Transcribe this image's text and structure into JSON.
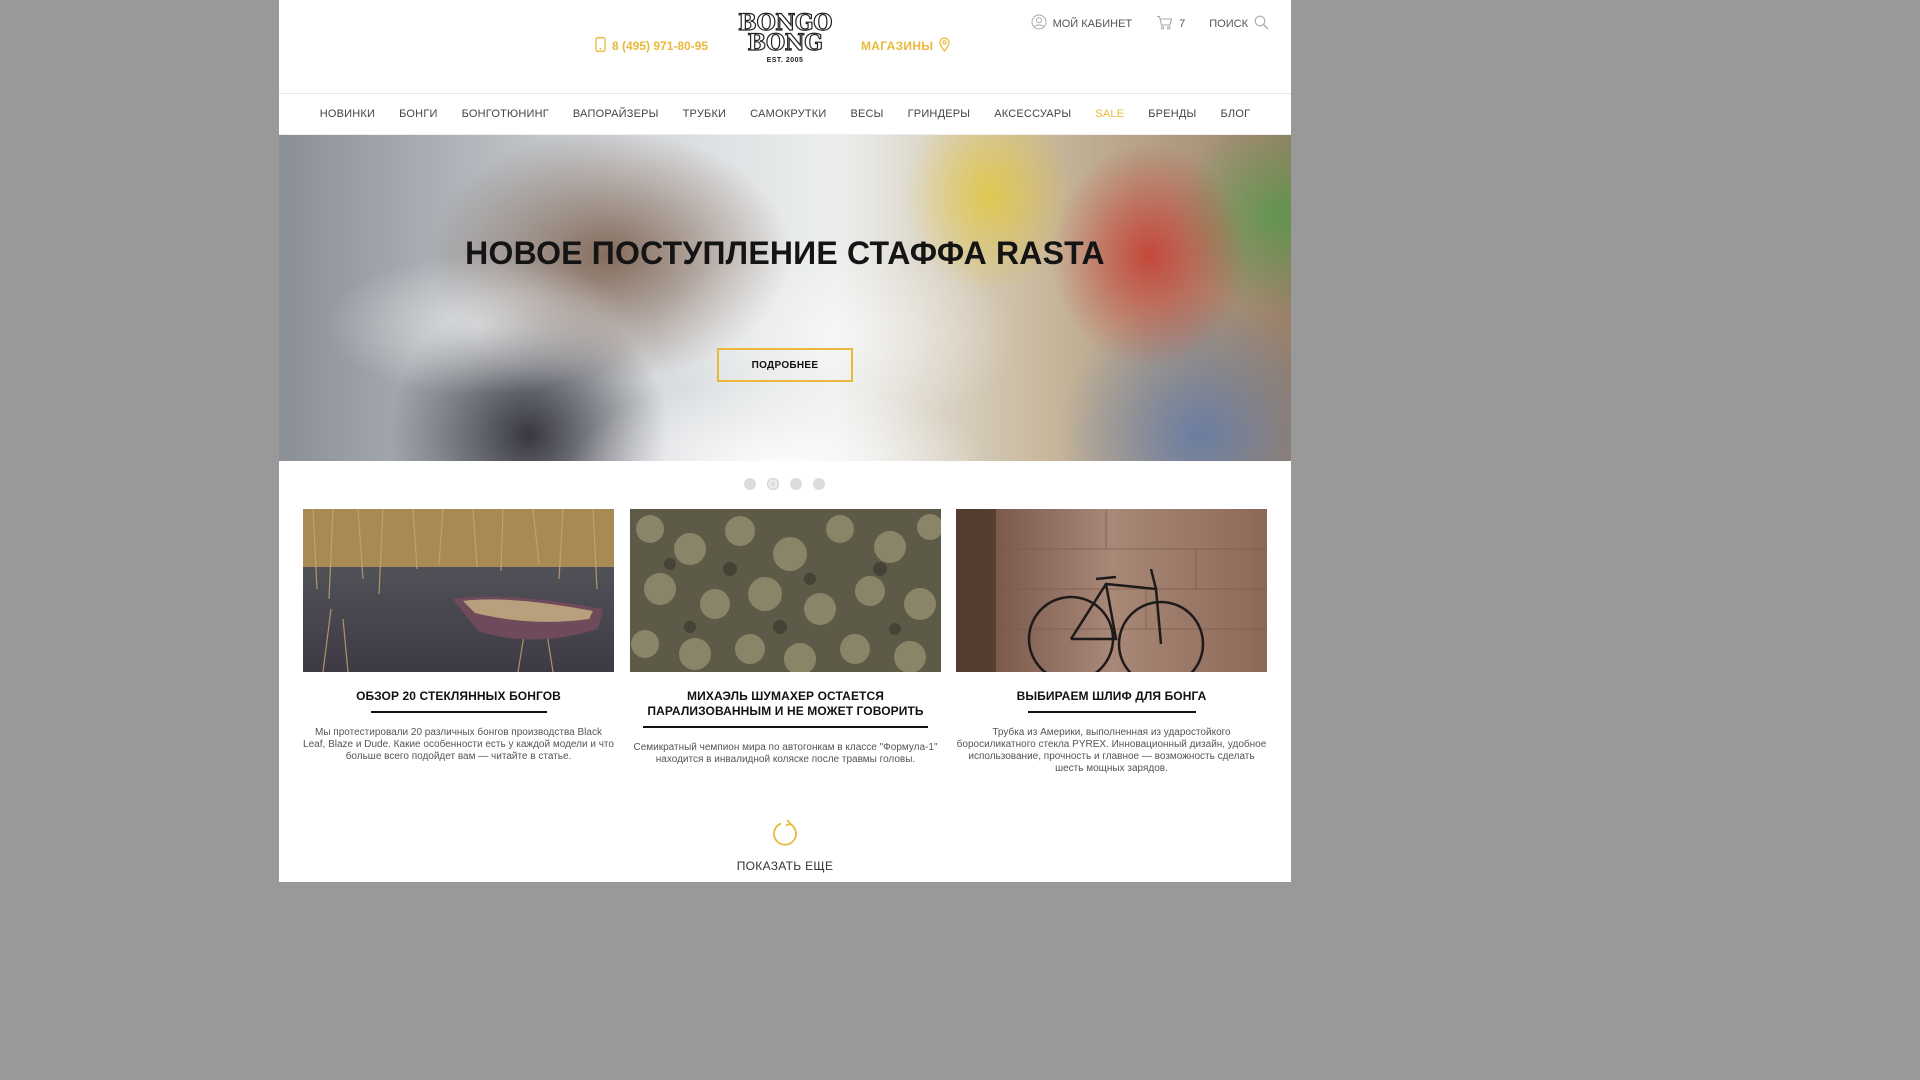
{
  "header": {
    "phone": "8 (495) 971-80-95",
    "stores": "МАГАЗИНЫ",
    "logo_top": "BONGO",
    "logo_bottom": "BONG",
    "logo_est": "EST. 2005",
    "account": "МОЙ КАБИНЕТ",
    "cart_count": "7",
    "search": "ПОИСК"
  },
  "nav": {
    "items": [
      "НОВИНКИ",
      "БОНГИ",
      "БОНГОТЮНИНГ",
      "ВАПОРАЙЗЕРЫ",
      "ТРУБКИ",
      "САМОКРУТКИ",
      "ВЕСЫ",
      "ГРИНДЕРЫ",
      "АКСЕССУАРЫ",
      "SALE",
      "БРЕНДЫ",
      "БЛОГ"
    ]
  },
  "hero": {
    "title": "НОВОЕ ПОСТУПЛЕНИЕ СТАФФА RASTA",
    "button": "ПОДРОБНЕЕ",
    "slide_count": 4,
    "active_slide": 2
  },
  "cards": [
    {
      "title": "ОБЗОР 20 СТЕКЛЯННЫХ БОНГОВ",
      "text": "Мы протестировали 20 различных бонгов производства Black Leaf, Blaze и Dude. Какие особенности есть у каждой модели и что больше всего подойдет вам — читайте в статье."
    },
    {
      "title": "МИХАЭЛЬ ШУМАХЕР ОСТАЕТСЯ ПАРАЛИЗОВАННЫМ И НЕ МОЖЕТ ГОВОРИТЬ",
      "text": "Семикратный чемпион мира по автогонкам в классе \"Формула-1\" находится в инвалидной коляске после травмы головы."
    },
    {
      "title": "ВЫБИРАЕМ ШЛИФ ДЛЯ БОНГА",
      "text": "Трубка из Америки, выполненная из ударостойкого боросиликатного стекла PYREX. Инновационный дизайн, удобное использование, прочность и главное — возможность сделать шесть мощных зарядов."
    }
  ],
  "more": {
    "label": "ПОКАЗАТЬ ЕЩЕ"
  },
  "colors": {
    "accent": "#e8b93a",
    "backdrop": "#999999"
  }
}
